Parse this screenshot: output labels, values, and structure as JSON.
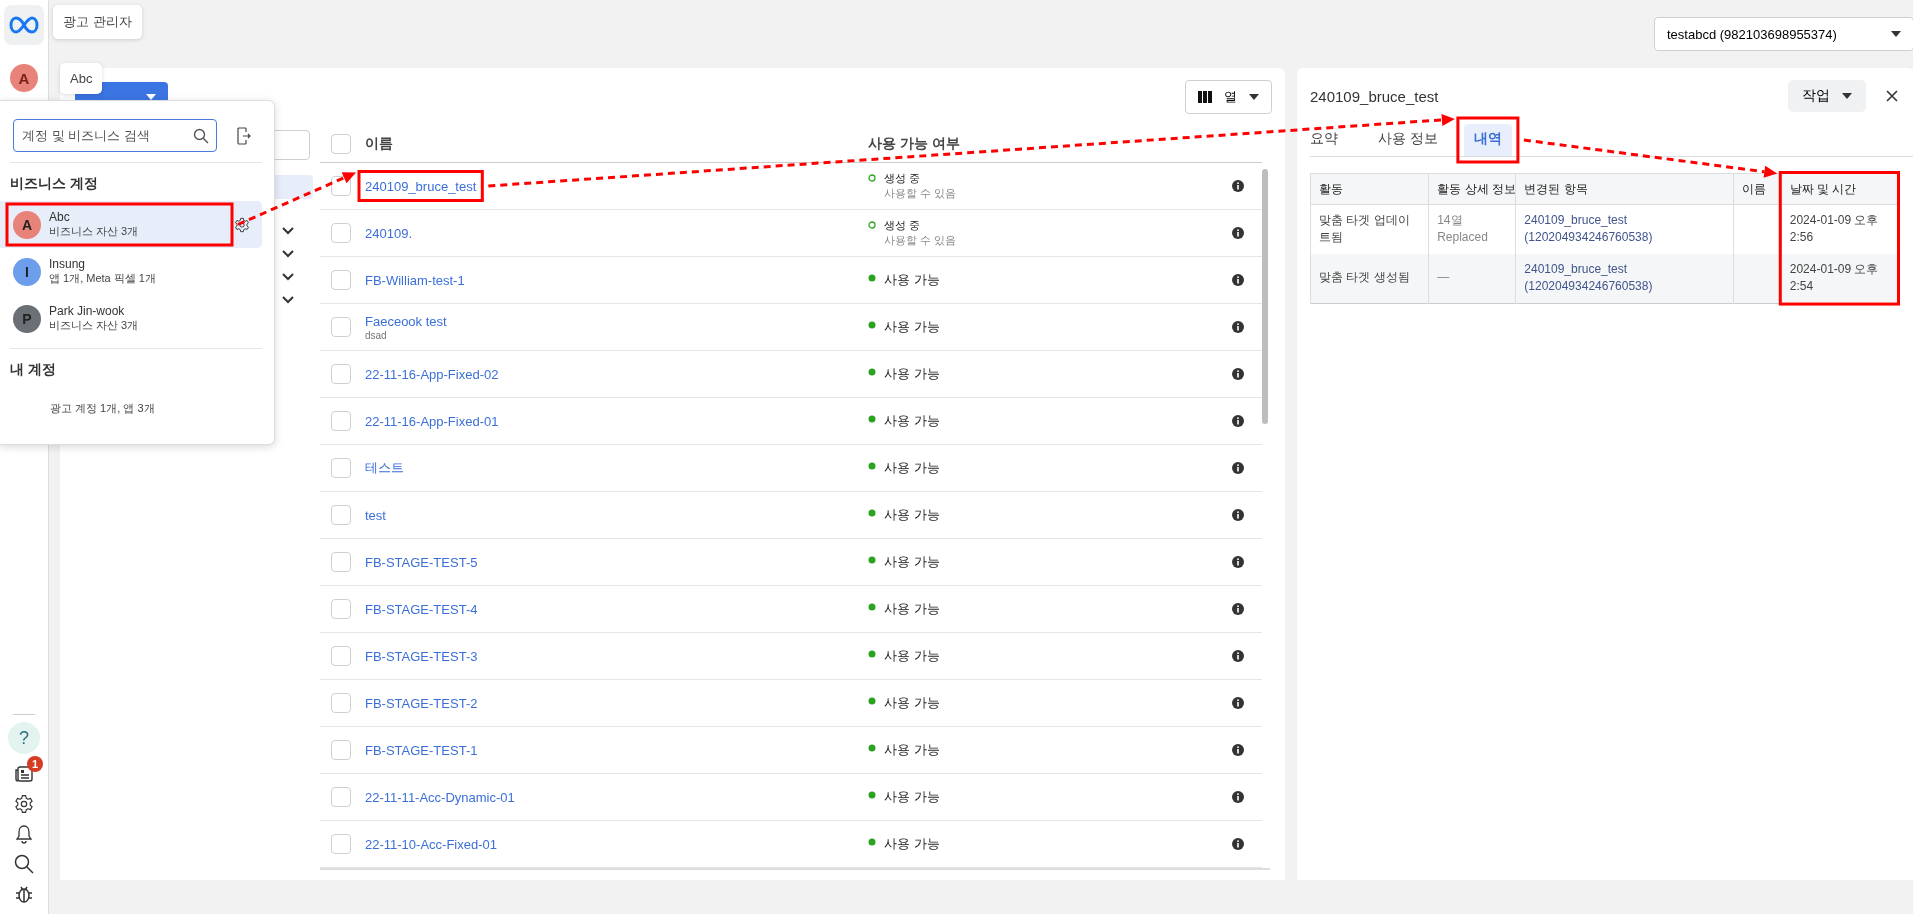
{
  "tooltips": [
    {
      "text": "광고 관리자"
    },
    {
      "text": "Abc"
    }
  ],
  "rail": {
    "avatar": "A",
    "help": "?",
    "notification_badge": "1"
  },
  "account_select": {
    "value": "testabcd (982103698955374)"
  },
  "columns_button": {
    "label": "열"
  },
  "table": {
    "columns": [
      "이름",
      "사용 가능 여부"
    ],
    "select_all_checked": false,
    "rows": [
      {
        "name": "240109_bruce_test",
        "checked": false,
        "highlighted": true,
        "kind": "creating",
        "status": "생성 중",
        "status_detail": "사용할 수 있음"
      },
      {
        "name": "240109.",
        "checked": false,
        "highlighted": false,
        "kind": "creating",
        "status": "생성 중",
        "status_detail": "사용할 수 있음"
      },
      {
        "name": "FB-William-test-1",
        "checked": false,
        "highlighted": false,
        "kind": "available",
        "status": "사용 가능"
      },
      {
        "name": "Faeceook test",
        "note": "dsad",
        "checked": false,
        "highlighted": false,
        "kind": "available",
        "status": "사용 가능"
      },
      {
        "name": "22-11-16-App-Fixed-02",
        "checked": false,
        "highlighted": false,
        "kind": "available",
        "status": "사용 가능"
      },
      {
        "name": "22-11-16-App-Fixed-01",
        "checked": false,
        "highlighted": false,
        "kind": "available",
        "status": "사용 가능"
      },
      {
        "name": "테스트",
        "checked": false,
        "highlighted": false,
        "kind": "available",
        "status": "사용 가능"
      },
      {
        "name": "test",
        "checked": false,
        "highlighted": false,
        "kind": "available",
        "status": "사용 가능"
      },
      {
        "name": "FB-STAGE-TEST-5",
        "checked": false,
        "highlighted": false,
        "kind": "available",
        "status": "사용 가능"
      },
      {
        "name": "FB-STAGE-TEST-4",
        "checked": false,
        "highlighted": false,
        "kind": "available",
        "status": "사용 가능"
      },
      {
        "name": "FB-STAGE-TEST-3",
        "checked": false,
        "highlighted": false,
        "kind": "available",
        "status": "사용 가능"
      },
      {
        "name": "FB-STAGE-TEST-2",
        "checked": false,
        "highlighted": false,
        "kind": "available",
        "status": "사용 가능"
      },
      {
        "name": "FB-STAGE-TEST-1",
        "checked": false,
        "highlighted": false,
        "kind": "available",
        "status": "사용 가능"
      },
      {
        "name": "22-11-11-Acc-Dynamic-01",
        "checked": false,
        "highlighted": false,
        "kind": "available",
        "status": "사용 가능"
      },
      {
        "name": "22-11-10-Acc-Fixed-01",
        "checked": false,
        "highlighted": false,
        "kind": "available",
        "status": "사용 가능"
      }
    ]
  },
  "account_menu": {
    "search": {
      "placeholder": "계정 및 비즈니스 검색"
    },
    "business_section": {
      "title": "비즈니스 계정",
      "items": [
        {
          "initial": "A",
          "name": "Abc",
          "detail": "비즈니스 자산 3개",
          "color": "#e8837a",
          "selected": true,
          "highlighted": true
        },
        {
          "initial": "I",
          "name": "Insung",
          "detail": "앱 1개, Meta 픽셀 1개",
          "color": "#6d9eeb",
          "selected": false,
          "highlighted": false
        },
        {
          "initial": "P",
          "name": "Park Jin-wook",
          "detail": "비즈니스 자산 3개",
          "color": "#6b6f76",
          "selected": false,
          "highlighted": false
        }
      ]
    },
    "personal_section": {
      "title": "내 계정",
      "detail": "광고 계정 1개, 앱 3개"
    }
  },
  "detail_panel": {
    "title": "240109_bruce_test",
    "action_button": "작업",
    "tabs": [
      {
        "label": "요약",
        "selected": false,
        "highlighted": false
      },
      {
        "label": "사용 정보",
        "selected": false,
        "highlighted": false
      },
      {
        "label": "내역",
        "selected": true,
        "highlighted": true
      }
    ],
    "history": {
      "columns": [
        {
          "label": "활동",
          "highlighted": false
        },
        {
          "label": "활동 상세 정보",
          "highlighted": false
        },
        {
          "label": "변경된 항목",
          "highlighted": false
        },
        {
          "label": "이름",
          "highlighted": false
        },
        {
          "label": "날짜 및 시간",
          "highlighted": true
        }
      ],
      "rows": [
        {
          "activity": "맞춤 타겟 업데이트됨",
          "details": "14열 Replaced",
          "changed_item": "240109_bruce_test",
          "changed_id": "(120204934246760538)",
          "date": "2024-01-09 오후 2:56"
        },
        {
          "activity": "맞춤 타겟 생성됨",
          "details": "—",
          "changed_item": "240109_bruce_test",
          "changed_id": "(120204934246760538)",
          "date": "2024-01-09 오후 2:54"
        }
      ]
    }
  }
}
